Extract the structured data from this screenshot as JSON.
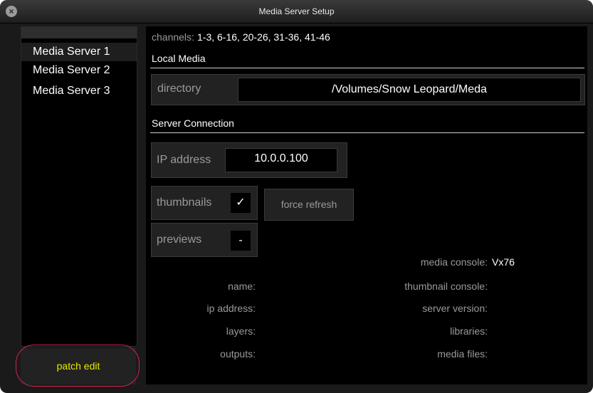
{
  "window": {
    "title": "Media Server Setup"
  },
  "sidebar": {
    "items": [
      {
        "label": "Media Server 1",
        "selected": true
      },
      {
        "label": "Media Server 2",
        "selected": false
      },
      {
        "label": "Media Server 3",
        "selected": false
      }
    ],
    "patch_edit_label": "patch edit"
  },
  "main": {
    "channels_label": "channels:",
    "channels_value": "1-3, 6-16, 20-26, 31-36, 41-46",
    "local_media": {
      "heading": "Local Media",
      "directory_label": "directory",
      "directory_value": "/Volumes/Snow Leopard/Meda"
    },
    "server_connection": {
      "heading": "Server Connection",
      "ip_label": "IP address",
      "ip_value": "10.0.0.100",
      "thumbnails_label": "thumbnails",
      "thumbnails_value": "✓",
      "force_refresh_label": "force refresh",
      "previews_label": "previews",
      "previews_value": "-"
    },
    "info": {
      "media_console_label": "media console:",
      "media_console_value": "Vx76",
      "name_label": "name:",
      "thumbnail_console_label": "thumbnail console:",
      "ip_address_label": "ip address:",
      "server_version_label": "server version:",
      "layers_label": "layers:",
      "libraries_label": "libraries:",
      "outputs_label": "outputs:",
      "media_files_label": "media files:"
    }
  },
  "colors": {
    "highlight_ring": "#d8204f",
    "patch_text": "#e8e800"
  }
}
